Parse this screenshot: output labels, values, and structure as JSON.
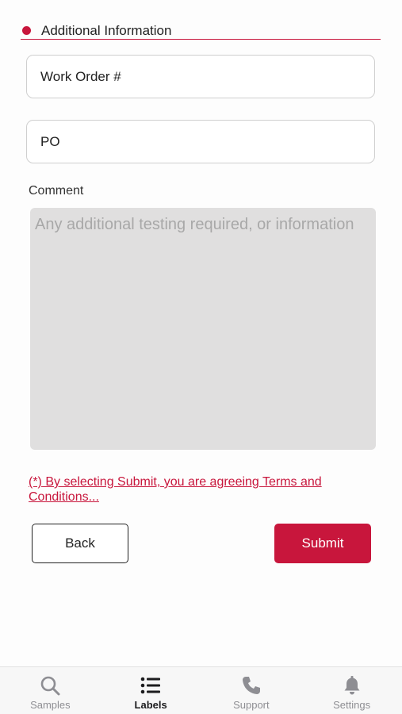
{
  "section": {
    "title": "Additional Information"
  },
  "fields": {
    "work_order": "Work Order #",
    "po": "PO"
  },
  "comment": {
    "label": "Comment",
    "placeholder": "Any additional testing required, or information"
  },
  "terms": {
    "text": "(*) By selecting Submit, you are agreeing Terms and Conditions..."
  },
  "actions": {
    "back_label": "Back",
    "submit_label": "Submit"
  },
  "tabbar": {
    "items": [
      {
        "label": "Samples",
        "icon": "search-icon"
      },
      {
        "label": "Labels",
        "icon": "list-icon",
        "active": true
      },
      {
        "label": "Support",
        "icon": "phone-icon"
      },
      {
        "label": "Settings",
        "icon": "bell-icon"
      }
    ]
  },
  "colors": {
    "accent": "#c8163c",
    "comment_bg": "#e0dfdf",
    "tab_inactive": "#8e8e93"
  }
}
